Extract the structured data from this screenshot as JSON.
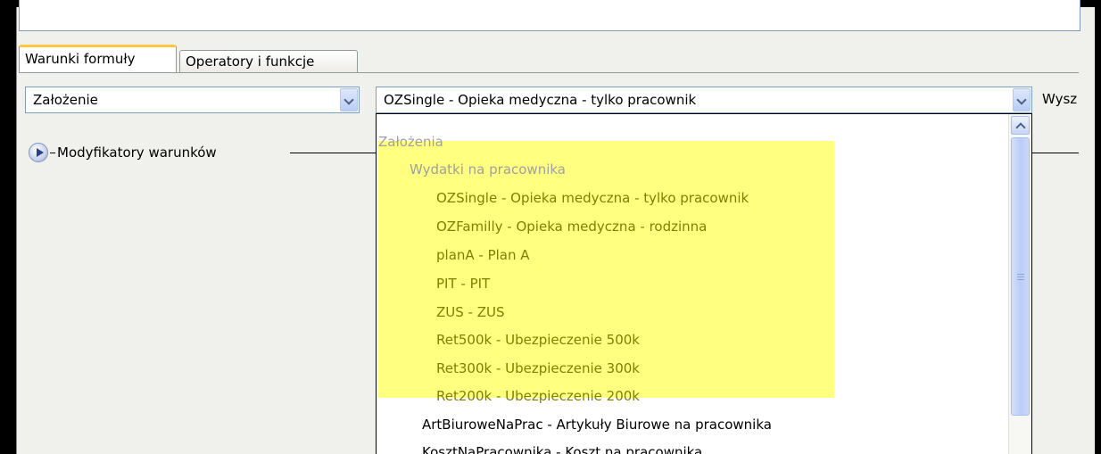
{
  "tabs": [
    {
      "label": "Warunki formuły",
      "active": true
    },
    {
      "label": "Operatory i funkcje",
      "active": false
    }
  ],
  "filters": {
    "type_select": {
      "value": "Założenie"
    },
    "item_select": {
      "value": "OZSingle - Opieka medyczna - tylko pracownik"
    },
    "trailing_label": "Wysz"
  },
  "modifiers": {
    "label": "Modyfikatory warunków"
  },
  "dropdown": {
    "group_header": "Założenia",
    "subgroup": "Wydatki na pracownika",
    "highlighted_items": [
      "OZSingle - Opieka medyczna - tylko pracownik",
      "OZFamilly - Opieka medyczna - rodzinna",
      "planA - Plan A",
      "PIT - PIT",
      "ZUS - ZUS",
      "Ret500k - Ubezpieczenie 500k",
      "Ret300k - Ubezpieczenie 300k",
      "Ret200k - Ubezpieczenie 200k"
    ],
    "other_items": [
      "ArtBiuroweNaPrac - Artykuły Biurowe na pracownika",
      "KosztNaPracownika - Koszt na pracownika"
    ]
  },
  "colors": {
    "highlight": "#ffff80",
    "highlight_text": "#808000",
    "disabled_text": "#a0a0a0",
    "tab_accent": "#ffc83c"
  },
  "icons": {
    "expand": "play-circle-icon",
    "combo_arrow": "chevron-down-icon",
    "scroll_up": "chevron-up-icon"
  }
}
